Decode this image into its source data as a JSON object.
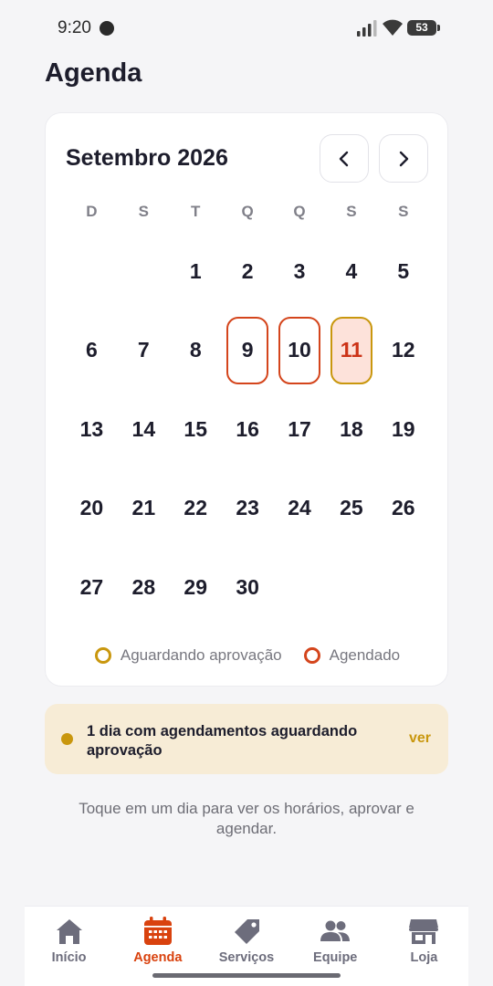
{
  "status": {
    "time": "9:20",
    "battery": "53"
  },
  "page": {
    "title": "Agenda"
  },
  "calendar": {
    "month": "Setembro 2026",
    "weekdays": [
      "D",
      "S",
      "T",
      "Q",
      "Q",
      "S",
      "S"
    ],
    "leading_blanks": 2,
    "days": [
      "1",
      "2",
      "3",
      "4",
      "5",
      "6",
      "7",
      "8",
      "9",
      "10",
      "11",
      "12",
      "13",
      "14",
      "15",
      "16",
      "17",
      "18",
      "19",
      "20",
      "21",
      "22",
      "23",
      "24",
      "25",
      "26",
      "27",
      "28",
      "29",
      "30"
    ],
    "scheduled_days": [
      "9",
      "10"
    ],
    "pending_days": [
      "11"
    ],
    "legend": {
      "pending": "Aguardando aprovação",
      "scheduled": "Agendado"
    }
  },
  "alert": {
    "text": "1 dia com agendamentos aguardando aprovação",
    "link": "ver"
  },
  "hint": "Toque em um dia para ver os horários, aprovar e agendar.",
  "bottom_nav": [
    {
      "label": "Início",
      "icon": "home-icon",
      "active": false
    },
    {
      "label": "Agenda",
      "icon": "calendar-icon",
      "active": true
    },
    {
      "label": "Serviços",
      "icon": "tag-icon",
      "active": false
    },
    {
      "label": "Equipe",
      "icon": "users-icon",
      "active": false
    },
    {
      "label": "Loja",
      "icon": "store-icon",
      "active": false
    }
  ],
  "colors": {
    "scheduled": "#d4451c",
    "pending": "#c9970e",
    "active_nav": "#d9420e",
    "inactive_nav": "#6d6d7c"
  }
}
